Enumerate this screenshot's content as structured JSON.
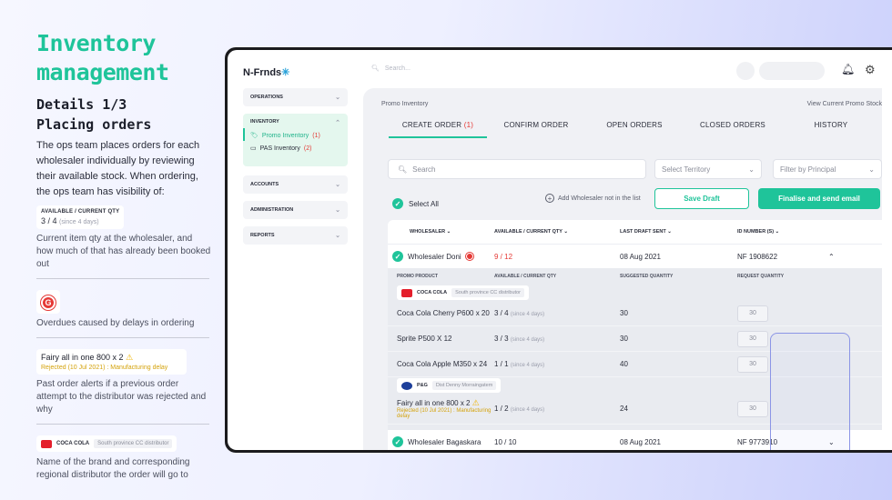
{
  "left": {
    "hero": "Inventory management",
    "subtitle1": "Details 1/3",
    "subtitle2": "Placing orders",
    "intro": "The ops team places orders for each wholesaler individually by reviewing their available stock. When ordering, the ops team has visibility of:",
    "card1": {
      "label": "AVAILABLE / CURRENT QTY",
      "value": "3 / 4",
      "since": "(since 4 days)"
    },
    "desc1": "Current item qty at the wholesaler, and how much of that has already been booked out",
    "desc2": "Overdues caused by delays in ordering",
    "card3": {
      "title": "Fairy all in one 800 x 2",
      "warn": "⚠",
      "sub": "Rejected (10 Jul 2021) : Manufacturing delay"
    },
    "desc3": "Past order alerts if a previous order attempt to the distributor was rejected and why",
    "card4": {
      "brand": "COCA COLA",
      "distributor": "South province CC distributor"
    },
    "desc4": "Name of the brand and corresponding regional distributor the order will go to"
  },
  "app": {
    "logo": "N-Frnds",
    "search_placeholder": "Search...",
    "sidebar": {
      "operations": "OPERATIONS",
      "inventory": "INVENTORY",
      "promo_inventory": "Promo Inventory",
      "promo_count": "(1)",
      "pas_inventory": "PAS Inventory",
      "pas_count": "(2)",
      "accounts": "ACCOUNTS",
      "administration": "ADMINISTRATION",
      "reports": "REPORTS"
    },
    "breadcrumb": "Promo Inventory",
    "view_link": "View Current Promo Stock",
    "tabs": [
      {
        "label": "CREATE ORDER",
        "count": "(1)"
      },
      {
        "label": "CONFIRM ORDER",
        "count": ""
      },
      {
        "label": "OPEN ORDERS",
        "count": ""
      },
      {
        "label": "CLOSED ORDERS",
        "count": ""
      },
      {
        "label": "HISTORY",
        "count": ""
      }
    ],
    "search_label": "Search",
    "select_territory": "Select Territory",
    "filter_principal": "Filter by Principal",
    "select_all": "Select All",
    "add_wholesaler": "Add Wholesaler not in the list",
    "save_draft": "Save Draft",
    "finalise": "Finalise and send email",
    "columns": [
      "WHOLESALER",
      "AVAILABLE / CURRENT QTY",
      "LAST DRAFT SENT",
      "ID NUMBER (S)"
    ],
    "rows": [
      {
        "name": "Wholesaler Doni",
        "qty": "9 / 12",
        "date": "08 Aug 2021",
        "id": "NF 1908622"
      },
      {
        "name": "Wholesaler Bagaskara",
        "qty": "10 / 10",
        "date": "08 Aug 2021",
        "id": "NF 9773910"
      }
    ],
    "inner_columns": [
      "PROMO PRODUCT",
      "AVAILABLE / CURRENT QTY",
      "SUGGESTED QUANTITY",
      "REQUEST QUANTITY"
    ],
    "brand1": {
      "name": "COCA COLA",
      "distributor": "South province CC distributor"
    },
    "brand2": {
      "name": "P&G",
      "distributor": "Dist Denny Morraingatem"
    },
    "products": [
      {
        "name": "Coca Cola Cherry P600 x 20",
        "qty": "3 / 4",
        "since": "(since 4 days)",
        "suggested": "30",
        "request": "30"
      },
      {
        "name": "Sprite P500 X 12",
        "qty": "3 / 3",
        "since": "(since 4 days)",
        "suggested": "30",
        "request": "30"
      },
      {
        "name": "Coca Cola Apple M350 x 24",
        "qty": "1 / 1",
        "since": "(since 4 days)",
        "suggested": "40",
        "request": "30"
      },
      {
        "name": "Fairy all in one 800 x 2",
        "qty": "1 / 2",
        "since": "(since 4 days)",
        "suggested": "24",
        "request": "30",
        "rejected": "Rejected (10 Jul 2021) : Manufacturing delay"
      }
    ],
    "colors": {
      "accent": "#1fc49a",
      "alert": "#e53935",
      "highlight": "#8b95e6"
    }
  }
}
